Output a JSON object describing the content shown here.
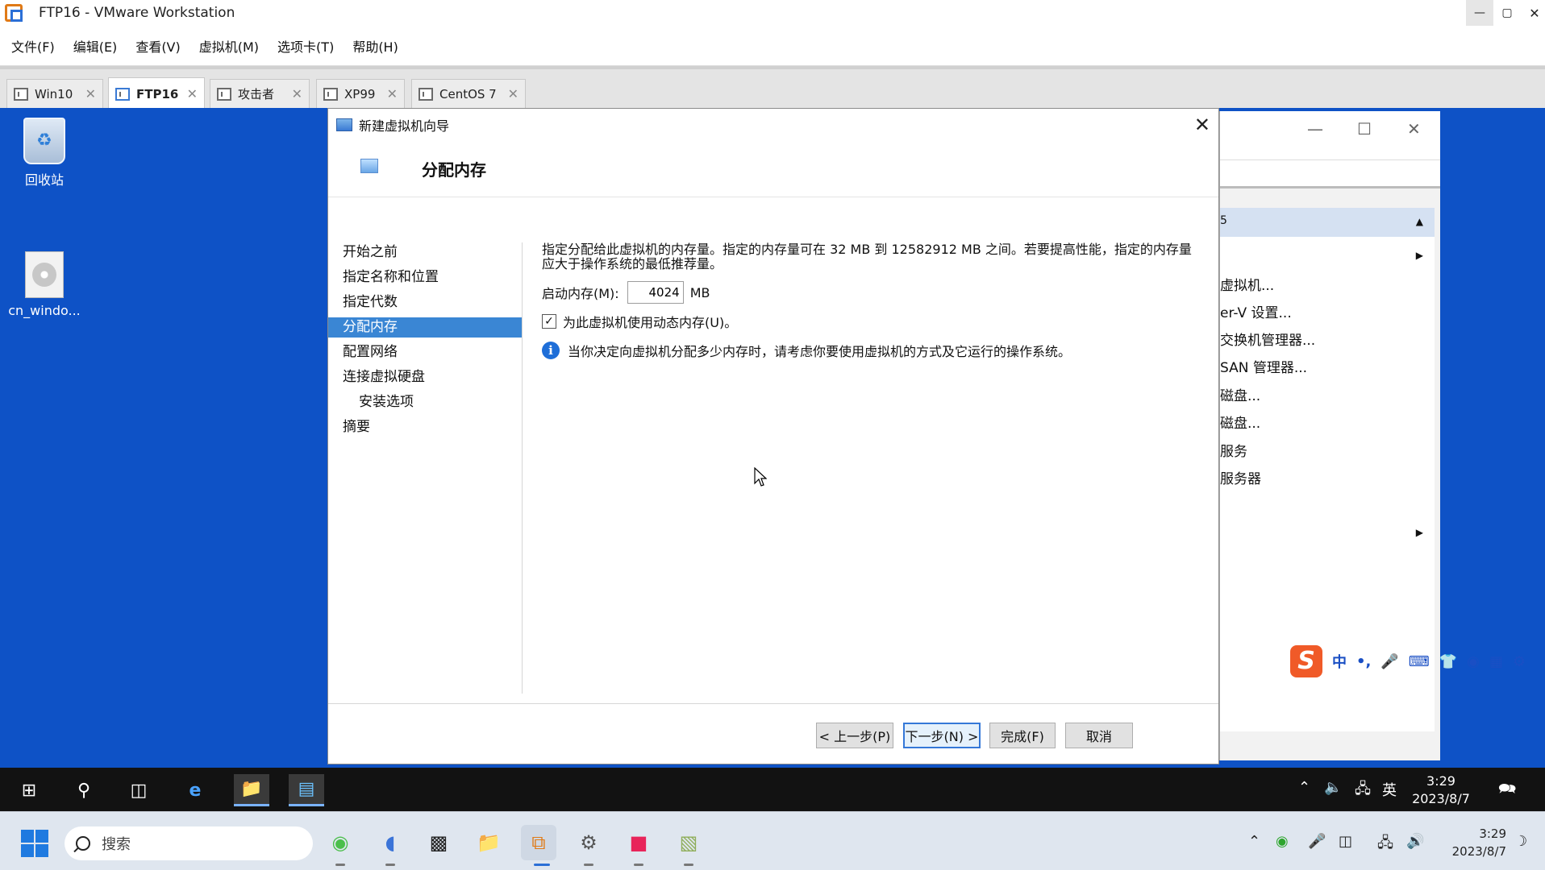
{
  "window": {
    "title": "FTP16 - VMware Workstation",
    "min_icon": "minimize-icon",
    "max_icon": "maximize-icon",
    "close_icon": "close-icon"
  },
  "menu": [
    "文件(F)",
    "编辑(E)",
    "查看(V)",
    "虚拟机(M)",
    "选项卡(T)",
    "帮助(H)"
  ],
  "tabs": [
    {
      "label": "Win10",
      "active": false
    },
    {
      "label": "FTP16",
      "active": true
    },
    {
      "label": "攻击者",
      "active": false
    },
    {
      "label": "XP99",
      "active": false
    },
    {
      "label": "CentOS 7",
      "active": false
    }
  ],
  "desktop": {
    "icons": [
      {
        "label": "回收站",
        "icon": "recycle-bin-icon"
      },
      {
        "label": "cn_windo...",
        "icon": "disc-image-icon"
      }
    ]
  },
  "bg_window": {
    "header_text": "5",
    "items": [
      "虚拟机...",
      "er-V 设置...",
      "交换机管理器...",
      "SAN 管理器...",
      "磁盘...",
      "磁盘...",
      "服务",
      "服务器"
    ]
  },
  "dialog": {
    "title": "新建虚拟机向导",
    "header": "分配内存",
    "nav": [
      "开始之前",
      "指定名称和位置",
      "指定代数",
      "分配内存",
      "配置网络",
      "连接虚拟硬盘",
      "安装选项",
      "摘要"
    ],
    "active_nav": "分配内存",
    "description": "指定分配给此虚拟机的内存量。指定的内存量可在 32 MB 到 12582912 MB 之间。若要提高性能，指定的内存量应大于操作系统的最低推荐量。",
    "startup_memory_label": "启动内存(M):",
    "startup_memory_value": "4024",
    "memory_unit": "MB",
    "dynamic_memory_label": "为此虚拟机使用动态内存(U)。",
    "dynamic_memory_checked": true,
    "info_text": "当你决定向虚拟机分配多少内存时，请考虑你要使用虚拟机的方式及它运行的操作系统。",
    "buttons": {
      "prev": "< 上一步(P)",
      "next": "下一步(N) >",
      "finish": "完成(F)",
      "cancel": "取消"
    }
  },
  "ime": {
    "logo": "S",
    "mode": "中",
    "punct": "•,",
    "items": [
      "microphone-icon",
      "keyboard-icon",
      "skin-icon",
      "game-icon",
      "apps-icon",
      "settings-icon"
    ]
  },
  "guest_taskbar": {
    "ime_lang": "英",
    "time": "3:29",
    "date": "2023/8/7",
    "notification_count": "1"
  },
  "host_taskbar": {
    "search_placeholder": "搜索",
    "time": "3:29",
    "date": "2023/8/7"
  },
  "colors": {
    "guest_desktop": "#0e52c6",
    "nav_active": "#3a86d4",
    "primary_button_border": "#3478d8"
  }
}
